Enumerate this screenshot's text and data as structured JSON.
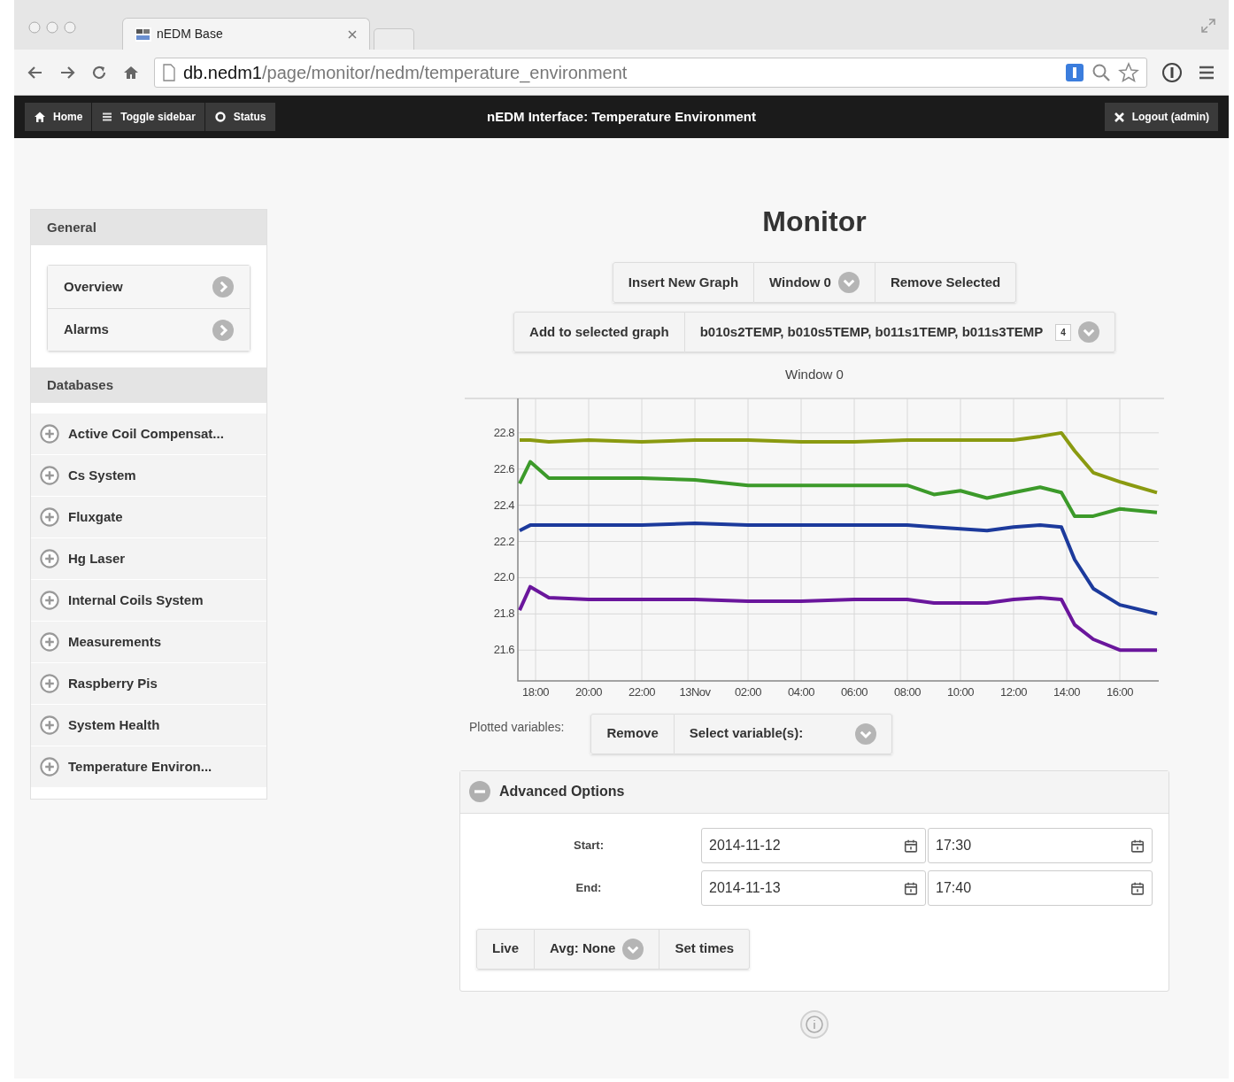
{
  "browser": {
    "tab_title": "nEDM Base",
    "url_host": "db.nedm1",
    "url_path": "/page/monitor/nedm/temperature_environment"
  },
  "navbar": {
    "buttons": [
      {
        "label": "Home"
      },
      {
        "label": "Toggle sidebar"
      },
      {
        "label": "Status"
      }
    ],
    "title": "nEDM Interface: Temperature Environment",
    "logout": "Logout (admin)"
  },
  "sidebar": [
    {
      "title": "General",
      "kind": "links",
      "items": [
        {
          "label": "Overview"
        },
        {
          "label": "Alarms"
        }
      ]
    },
    {
      "title": "Databases",
      "kind": "databases",
      "items": [
        {
          "label": "Active Coil Compensat..."
        },
        {
          "label": "Cs System"
        },
        {
          "label": "Fluxgate"
        },
        {
          "label": "Hg Laser"
        },
        {
          "label": "Internal Coils System"
        },
        {
          "label": "Measurements"
        },
        {
          "label": "Raspberry Pis"
        },
        {
          "label": "System Health"
        },
        {
          "label": "Temperature Environ..."
        }
      ]
    }
  ],
  "monitor": {
    "title": "Monitor",
    "toolbar": {
      "insert": "Insert New Graph",
      "window_select": "Window 0",
      "remove": "Remove Selected"
    },
    "add_row": {
      "button": "Add to selected graph",
      "selection": "b010s2TEMP, b010s5TEMP, b011s1TEMP, b011s3TEMP",
      "count": "4"
    },
    "graph": {
      "title": "Window 0",
      "chart_data": {
        "type": "line",
        "grid": true,
        "x": [
          "2014-11-12T17:24",
          "2014-11-12T17:48",
          "2014-11-12T18:30",
          "2014-11-12T20:00",
          "2014-11-12T22:00",
          "2014-11-13T00:00",
          "2014-11-13T02:00",
          "2014-11-13T04:00",
          "2014-11-13T06:00",
          "2014-11-13T08:00",
          "2014-11-13T09:00",
          "2014-11-13T10:00",
          "2014-11-13T11:00",
          "2014-11-13T12:00",
          "2014-11-13T13:00",
          "2014-11-13T13:48",
          "2014-11-13T14:18",
          "2014-11-13T15:00",
          "2014-11-13T16:00",
          "2014-11-13T17:24"
        ],
        "series": [
          {
            "color": "#8a9a10",
            "values": [
              22.76,
              22.76,
              22.75,
              22.76,
              22.75,
              22.76,
              22.76,
              22.75,
              22.75,
              22.76,
              22.76,
              22.76,
              22.76,
              22.76,
              22.78,
              22.8,
              22.7,
              22.58,
              22.53,
              22.47
            ]
          },
          {
            "color": "#3c9a2a",
            "values": [
              22.52,
              22.64,
              22.55,
              22.55,
              22.55,
              22.54,
              22.51,
              22.51,
              22.51,
              22.51,
              22.46,
              22.48,
              22.44,
              22.47,
              22.5,
              22.47,
              22.34,
              22.34,
              22.38,
              22.36
            ]
          },
          {
            "color": "#1c3a9c",
            "values": [
              22.26,
              22.29,
              22.29,
              22.29,
              22.29,
              22.3,
              22.29,
              22.29,
              22.29,
              22.29,
              22.28,
              22.27,
              22.26,
              22.28,
              22.29,
              22.28,
              22.1,
              21.94,
              21.85,
              21.8
            ]
          },
          {
            "color": "#6a169c",
            "values": [
              21.82,
              21.95,
              21.89,
              21.88,
              21.88,
              21.88,
              21.87,
              21.87,
              21.88,
              21.88,
              21.86,
              21.86,
              21.86,
              21.88,
              21.89,
              21.88,
              21.74,
              21.66,
              21.6,
              21.6
            ]
          }
        ],
        "xlim": [
          "2014-11-12T17:20",
          "2014-11-13T17:28"
        ],
        "ylim": [
          21.43,
          22.99
        ],
        "xticks": [
          {
            "value": "2014-11-12T18:00",
            "label": "18:00"
          },
          {
            "value": "2014-11-12T20:00",
            "label": "20:00"
          },
          {
            "value": "2014-11-12T22:00",
            "label": "22:00"
          },
          {
            "value": "2014-11-13T00:00",
            "label": "13Nov"
          },
          {
            "value": "2014-11-13T02:00",
            "label": "02:00"
          },
          {
            "value": "2014-11-13T04:00",
            "label": "04:00"
          },
          {
            "value": "2014-11-13T06:00",
            "label": "06:00"
          },
          {
            "value": "2014-11-13T08:00",
            "label": "08:00"
          },
          {
            "value": "2014-11-13T10:00",
            "label": "10:00"
          },
          {
            "value": "2014-11-13T12:00",
            "label": "12:00"
          },
          {
            "value": "2014-11-13T14:00",
            "label": "14:00"
          },
          {
            "value": "2014-11-13T16:00",
            "label": "16:00"
          }
        ],
        "yticks": [
          {
            "value": 21.6,
            "label": "21.6"
          },
          {
            "value": 21.8,
            "label": "21.8"
          },
          {
            "value": 22.0,
            "label": "22.0"
          },
          {
            "value": 22.2,
            "label": "22.2"
          },
          {
            "value": 22.4,
            "label": "22.4"
          },
          {
            "value": 22.6,
            "label": "22.6"
          },
          {
            "value": 22.8,
            "label": "22.8"
          }
        ]
      }
    },
    "plotted": {
      "label": "Plotted variables:",
      "remove": "Remove",
      "select": "Select variable(s):"
    },
    "advanced": {
      "title": "Advanced Options",
      "expanded": true,
      "rows": [
        {
          "label": "Start:",
          "date": "2014-11-12",
          "time": "17:30"
        },
        {
          "label": "End:",
          "date": "2014-11-13",
          "time": "17:40"
        }
      ],
      "buttons": {
        "live": "Live",
        "avg": "Avg: None",
        "set": "Set times"
      }
    }
  }
}
